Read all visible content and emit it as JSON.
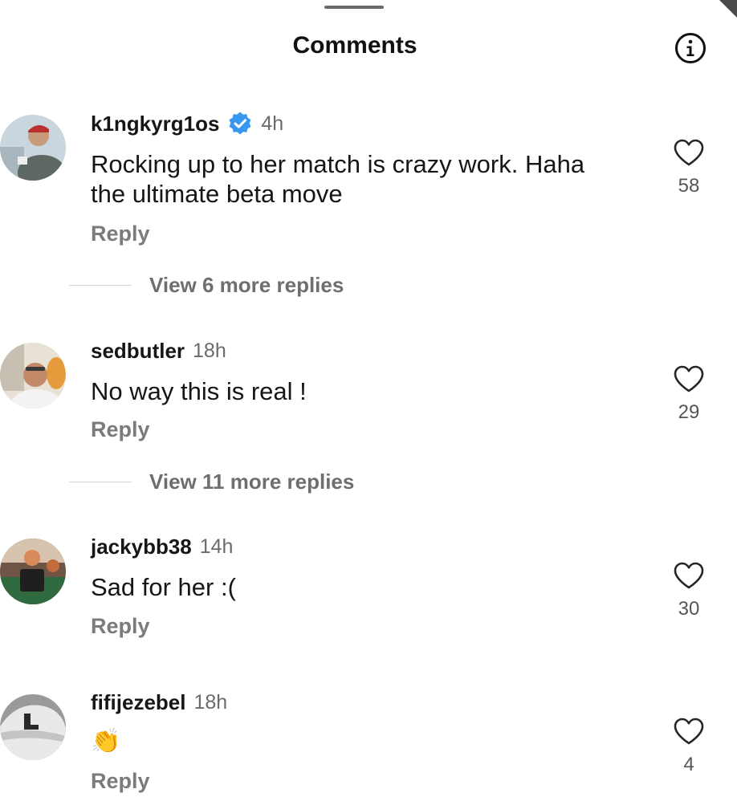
{
  "header": {
    "title": "Comments"
  },
  "icons": {
    "info": "info-icon",
    "like": "heart-outline-icon",
    "verified": "verified-badge-icon"
  },
  "colors": {
    "verified_blue": "#3897f0",
    "secondary_text": "#6b6b6b",
    "reply_text": "#7b7b7b"
  },
  "comments": [
    {
      "username": "k1ngkyrg1os",
      "verified": true,
      "time": "4h",
      "text_line1": "Rocking up to her match is crazy work. Haha",
      "text_line2": "the ultimate beta move",
      "reply_label": "Reply",
      "likes": "58",
      "view_replies": "View 6 more replies"
    },
    {
      "username": "sedbutler",
      "verified": false,
      "time": "18h",
      "text_line1": "No way this is real !",
      "reply_label": "Reply",
      "likes": "29",
      "view_replies": "View 11 more replies"
    },
    {
      "username": "jackybb38",
      "verified": false,
      "time": "14h",
      "text_line1": "Sad for her :(",
      "reply_label": "Reply",
      "likes": "30"
    },
    {
      "username": "fifijezebel",
      "verified": false,
      "time": "18h",
      "text_line1": "👏",
      "reply_label": "Reply",
      "likes": "4"
    }
  ]
}
